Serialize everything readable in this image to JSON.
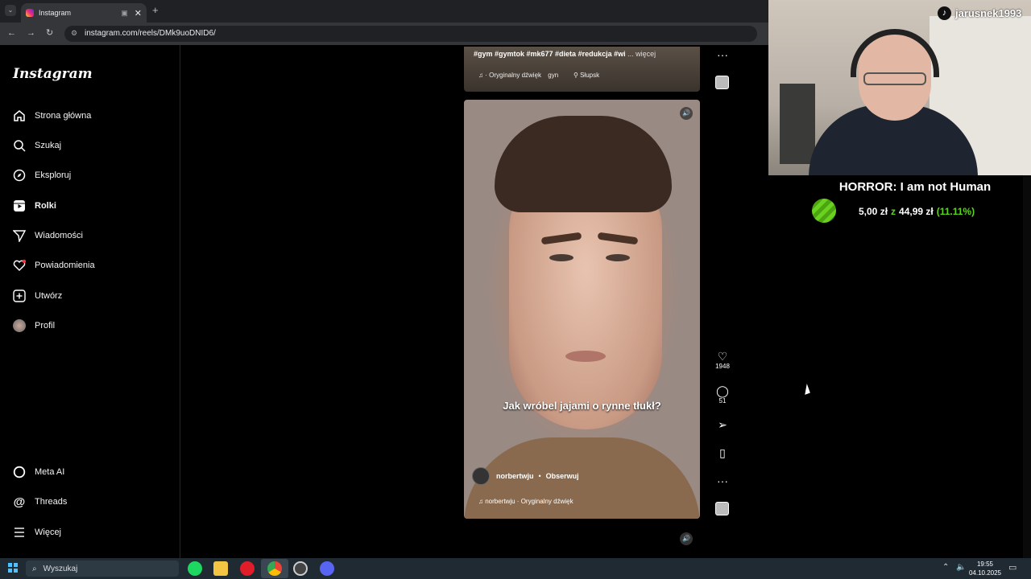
{
  "browser": {
    "tab_title": "Instagram",
    "url": "instagram.com/reels/DMk9uoDNID6/"
  },
  "sidebar": {
    "logo": "Instagram",
    "items": [
      {
        "label": "Strona główna",
        "icon": "home-icon"
      },
      {
        "label": "Szukaj",
        "icon": "search-icon"
      },
      {
        "label": "Eksploruj",
        "icon": "compass-icon"
      },
      {
        "label": "Rolki",
        "icon": "reels-icon"
      },
      {
        "label": "Wiadomości",
        "icon": "send-icon"
      },
      {
        "label": "Powiadomienia",
        "icon": "heart-icon"
      },
      {
        "label": "Utwórz",
        "icon": "plus-icon"
      },
      {
        "label": "Profil",
        "icon": "avatar"
      }
    ],
    "bottom_items": [
      {
        "label": "Meta AI",
        "icon": "meta-ai-icon"
      },
      {
        "label": "Threads",
        "icon": "threads-icon"
      },
      {
        "label": "Więcej",
        "icon": "menu-icon"
      }
    ]
  },
  "prev_reel": {
    "caption": "#gym #gymtok #mk677 #dieta #redukcja #wi",
    "more": "... więcej",
    "audio": "· Oryginalny dźwięk",
    "audio_tag": "gyn",
    "location": "Słupsk"
  },
  "reel": {
    "subtitle": "Jak wróbel jajami o rynne tłukł?",
    "author": "norbertwju",
    "follow": "Obserwuj",
    "audio": "norbertwju · Oryginalny dźwięk",
    "likes": "1948",
    "comments": "51"
  },
  "overlay": {
    "streamer": "jarusnek1993",
    "goal_title": "HORROR: I am not Human",
    "goal_current": "5,00 zł",
    "goal_sep": "z",
    "goal_target": "44,99 zł",
    "goal_pct": "(11.11%)"
  },
  "taskbar": {
    "search_placeholder": "Wyszukaj",
    "time": "19:55",
    "date": "04.10.2025"
  }
}
